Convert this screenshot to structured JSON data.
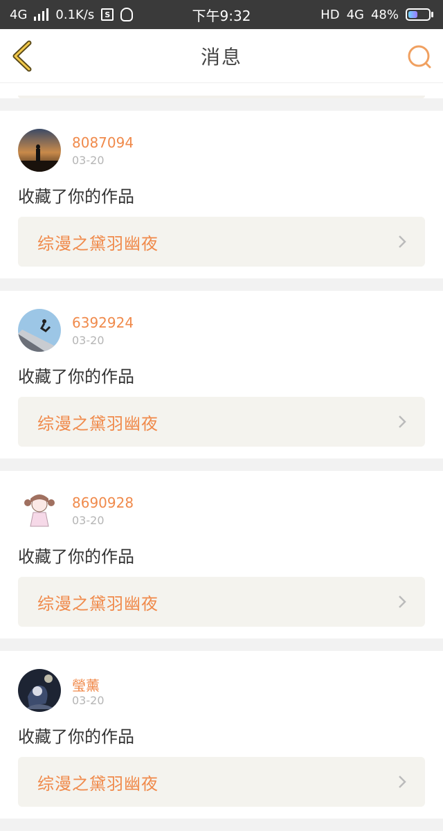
{
  "status_bar": {
    "network": "4G",
    "speed": "0.1K/s",
    "s_icon_label": "S",
    "time": "下午9:32",
    "hd": "HD",
    "network_right": "4G",
    "battery": "48%",
    "battery_level": 0.48
  },
  "nav": {
    "title": "消息",
    "accent_color": "#f08a4b"
  },
  "messages": [
    {
      "username": "8087094",
      "date": "03-20",
      "action": "收藏了你的作品",
      "work_title": "综漫之黛羽幽夜",
      "avatar": "silhouette-sunset-avatar"
    },
    {
      "username": "6392924",
      "date": "03-20",
      "action": "收藏了你的作品",
      "work_title": "综漫之黛羽幽夜",
      "avatar": "skater-sky-avatar"
    },
    {
      "username": "8690928",
      "date": "03-20",
      "action": "收藏了你的作品",
      "work_title": "综漫之黛羽幽夜",
      "avatar": "anime-girl-avatar"
    },
    {
      "username": "瑩薰",
      "date": "03-20",
      "action": "收藏了你的作品",
      "work_title": "综漫之黛羽幽夜",
      "avatar": "anime-dark-avatar"
    }
  ]
}
